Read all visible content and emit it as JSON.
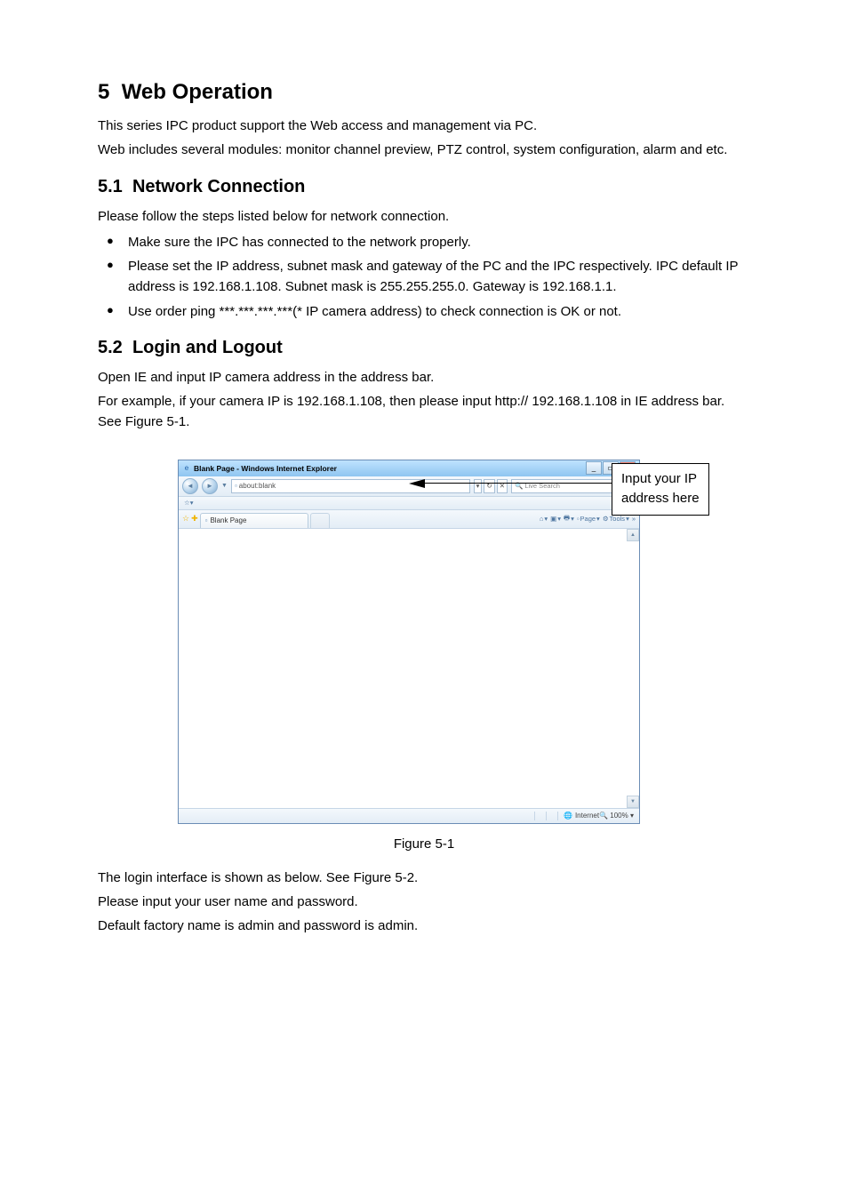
{
  "section": {
    "number": "5",
    "title": "Web Operation",
    "intro1": "This series IPC product support the Web access and management via PC.",
    "intro2": "Web includes several modules: monitor channel preview, PTZ control, system configuration, alarm and etc."
  },
  "sub1": {
    "number": "5.1",
    "title": "Network Connection",
    "lead": "Please follow the steps listed below for network connection.",
    "bullets": [
      "Make sure the IPC has connected to the network properly.",
      "Please set the IP address, subnet mask and gateway of the PC and the IPC respectively. IPC default IP address is 192.168.1.108. Subnet mask is 255.255.255.0. Gateway is 192.168.1.1.",
      "Use order ping ***.***.***.***(* IP camera address) to check connection is OK or not."
    ]
  },
  "sub2": {
    "number": "5.2",
    "title": "Login and Logout",
    "p1": "Open IE and input IP camera address in the address bar.",
    "p2": "For example, if your camera IP is 192.168.1.108, then please input http:// 192.168.1.108 in IE address bar. See Figure 5-1."
  },
  "ie": {
    "window_title": "Blank Page - Windows Internet Explorer",
    "address_text": "about:blank",
    "search_placeholder": "Live Search",
    "tab_label": "Blank Page",
    "toolbar": {
      "home": "",
      "feeds": "",
      "print": "",
      "page": "Page",
      "tools": "Tools"
    },
    "status_zone": "Internet",
    "status_zoom": "100%"
  },
  "callout": {
    "line1": "Input your IP",
    "line2": "address here"
  },
  "figure_caption": "Figure 5-1",
  "after": {
    "p1": "The login interface is shown as below. See Figure 5-2.",
    "p2": "Please input your user name and password.",
    "p3": "Default factory name is admin and password is admin."
  }
}
